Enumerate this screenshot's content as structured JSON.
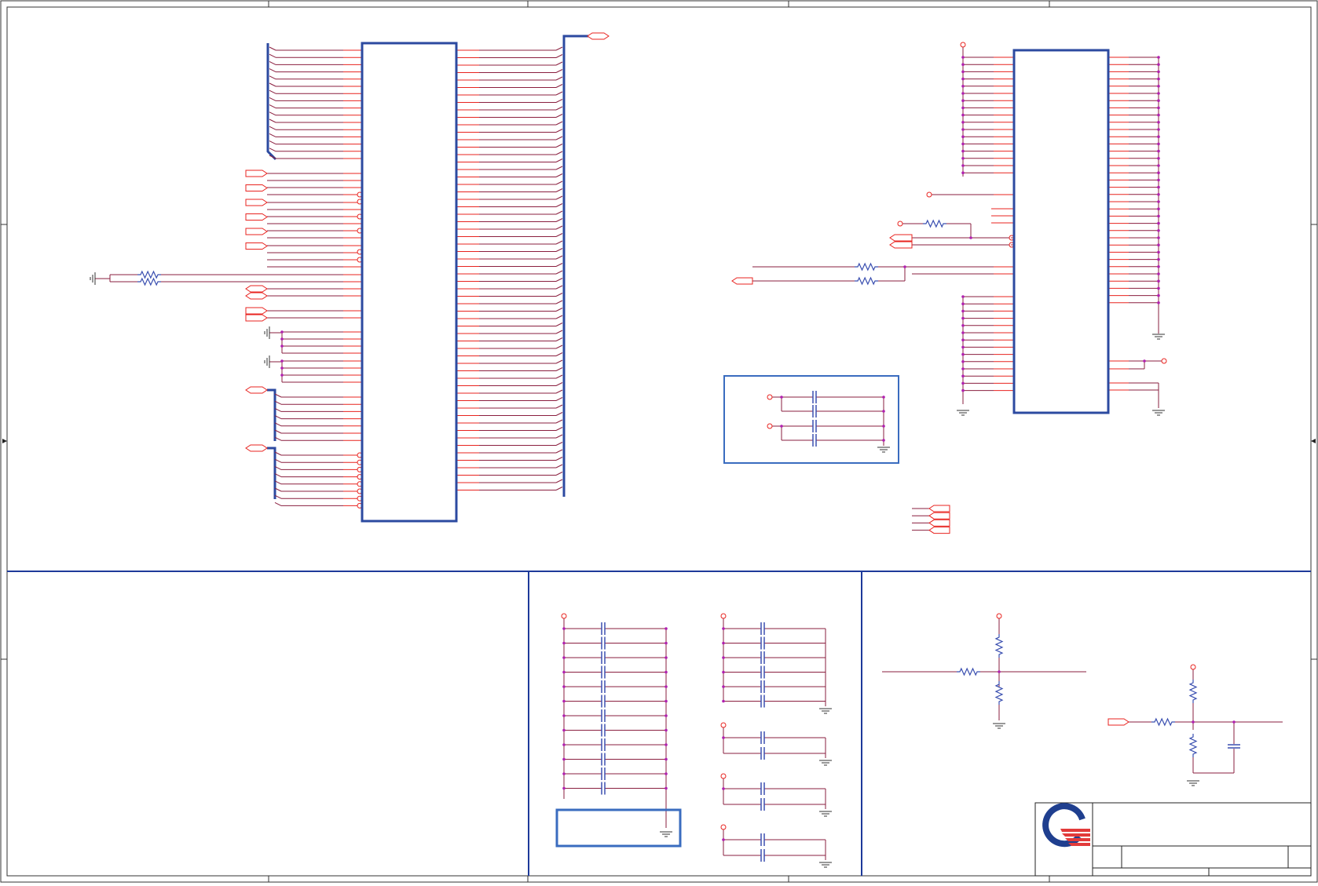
{
  "colors": {
    "wire": "#8a1f3f",
    "pin": "#e8231f",
    "component_box": "#2c4aa0",
    "group_box": "#3a6cbf",
    "border": "#1e3a9a",
    "junction": "#b020b0",
    "logo_blue": "#1f3f8f",
    "logo_red": "#e23a3a"
  },
  "icons": {
    "resistor": "resistor-icon",
    "capacitor": "capacitor-icon",
    "ground": "ground-icon",
    "port": "port-icon",
    "logo": "company-logo-icon"
  }
}
